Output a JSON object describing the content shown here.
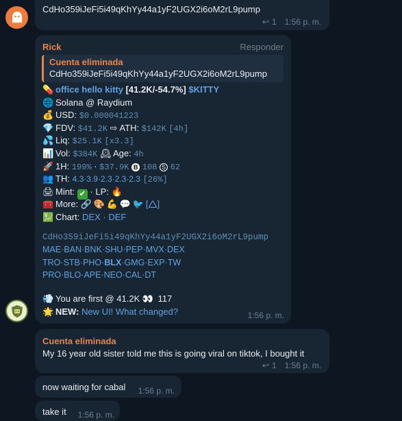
{
  "msg1": {
    "text": "CdHo359iJeFi5i49qKhYy44a1yF2UGX2i6oM2rL9pump",
    "reply_count": "1",
    "time": "1:56 p. m."
  },
  "msg2": {
    "sender": "Rick",
    "action": "Responder",
    "quote": {
      "title": "Cuenta eliminada",
      "text": "CdHo359iJeFi5i49qKhYy44a1yF2UGX2i6oM2rL9pump"
    },
    "token": {
      "name": "office hello kitty",
      "stats": "[41.2K/-54.7%]",
      "ticker": "$KITTY"
    },
    "chain": "Solana @ Raydium",
    "usd": {
      "label": "USD:",
      "value": "$0.000041223"
    },
    "fdv": {
      "label": "FDV:",
      "value": "$41.2K",
      "arrow": "⇨",
      "ath_label": "ATH:",
      "ath_value": "$142K",
      "ath_age": "[4h]"
    },
    "liq": {
      "label": "Liq:",
      "value": "$25.1K",
      "mult": "[x3.3]"
    },
    "vol": {
      "label": "Vol:",
      "value": "$384K",
      "age_label": "Age:",
      "age_value": "4h"
    },
    "h1": {
      "label": "1H:",
      "pct": "199%",
      "sep1": "·",
      "amount": "$37.9K",
      "buys": "108",
      "sells": "62"
    },
    "th": {
      "label": "TH:",
      "values": "4.3·3.9·2.3·2.3·2.3",
      "total": "[26%]"
    },
    "mint": {
      "label": "Mint:",
      "sep": "· LP:"
    },
    "more": {
      "label": "More:",
      "bracket": "[🛆]"
    },
    "chart": {
      "label": "Chart:",
      "dex": "DEX",
      "dot": "·",
      "def": "DEF"
    },
    "contract": "CdHo359iJeFi5i49qKhYy44a1yF2UGX2i6oM2rL9pump",
    "bots_row1": [
      "MAE",
      "BAN",
      "BNK",
      "SHU",
      "PEP",
      "MVX",
      "DEX"
    ],
    "bots_row2": [
      "TRO",
      "STB",
      "PHO",
      "BLX",
      "GMG",
      "EXP",
      "TW"
    ],
    "bots_row3": [
      "PRO",
      "BLO",
      "APE",
      "NEO",
      "CAL",
      "DT"
    ],
    "first": {
      "text": "You are first @ 41.2K",
      "count": "117"
    },
    "new": {
      "label": "NEW:",
      "link1": "New UI!",
      "link2": "What changed?"
    },
    "time": "1:56 p. m."
  },
  "msg3": {
    "sender": "Cuenta eliminada",
    "text": "My 16 year old sister told me this is going viral on tiktok, I bought it",
    "reply_count": "1",
    "time": "1:56 p. m."
  },
  "msg4": {
    "text": "now waiting for cabal",
    "time": "1:56 p. m."
  },
  "msg5": {
    "text": "take it",
    "time": "1:56 p. m."
  },
  "colors": {
    "background": "#0e1621",
    "bubble": "#182533",
    "accent_orange": "#e7844d",
    "link": "#62a2e0"
  }
}
